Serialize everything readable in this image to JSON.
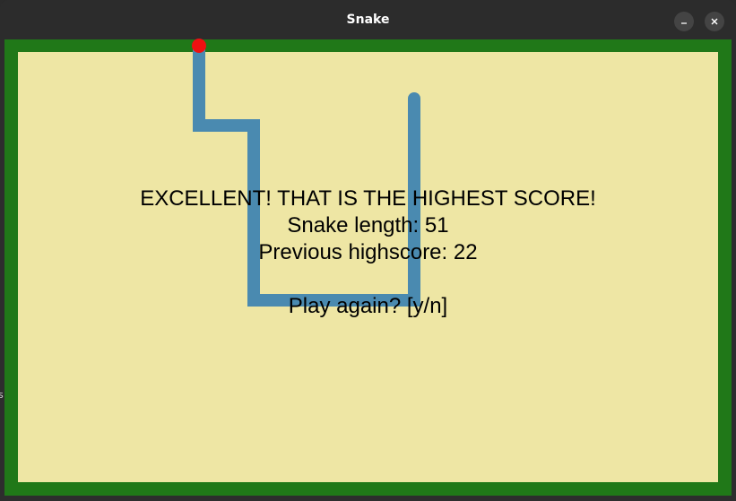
{
  "window": {
    "title": "Snake",
    "minimize_glyph": "–",
    "close_glyph": "×"
  },
  "game_over": {
    "headline": "EXCELLENT! THAT IS THE HIGHEST SCORE!",
    "length_text": "Snake length: 51",
    "previous_text": "Previous highscore: 22",
    "prompt": "Play again? [y/n]"
  },
  "colors": {
    "border": "#207818",
    "field": "#eee6a4",
    "snake": "#4a8ab0",
    "food": "#ee1111"
  },
  "icons": {
    "minimize": "minimize-icon",
    "close": "close-icon"
  },
  "edge_text": "s"
}
